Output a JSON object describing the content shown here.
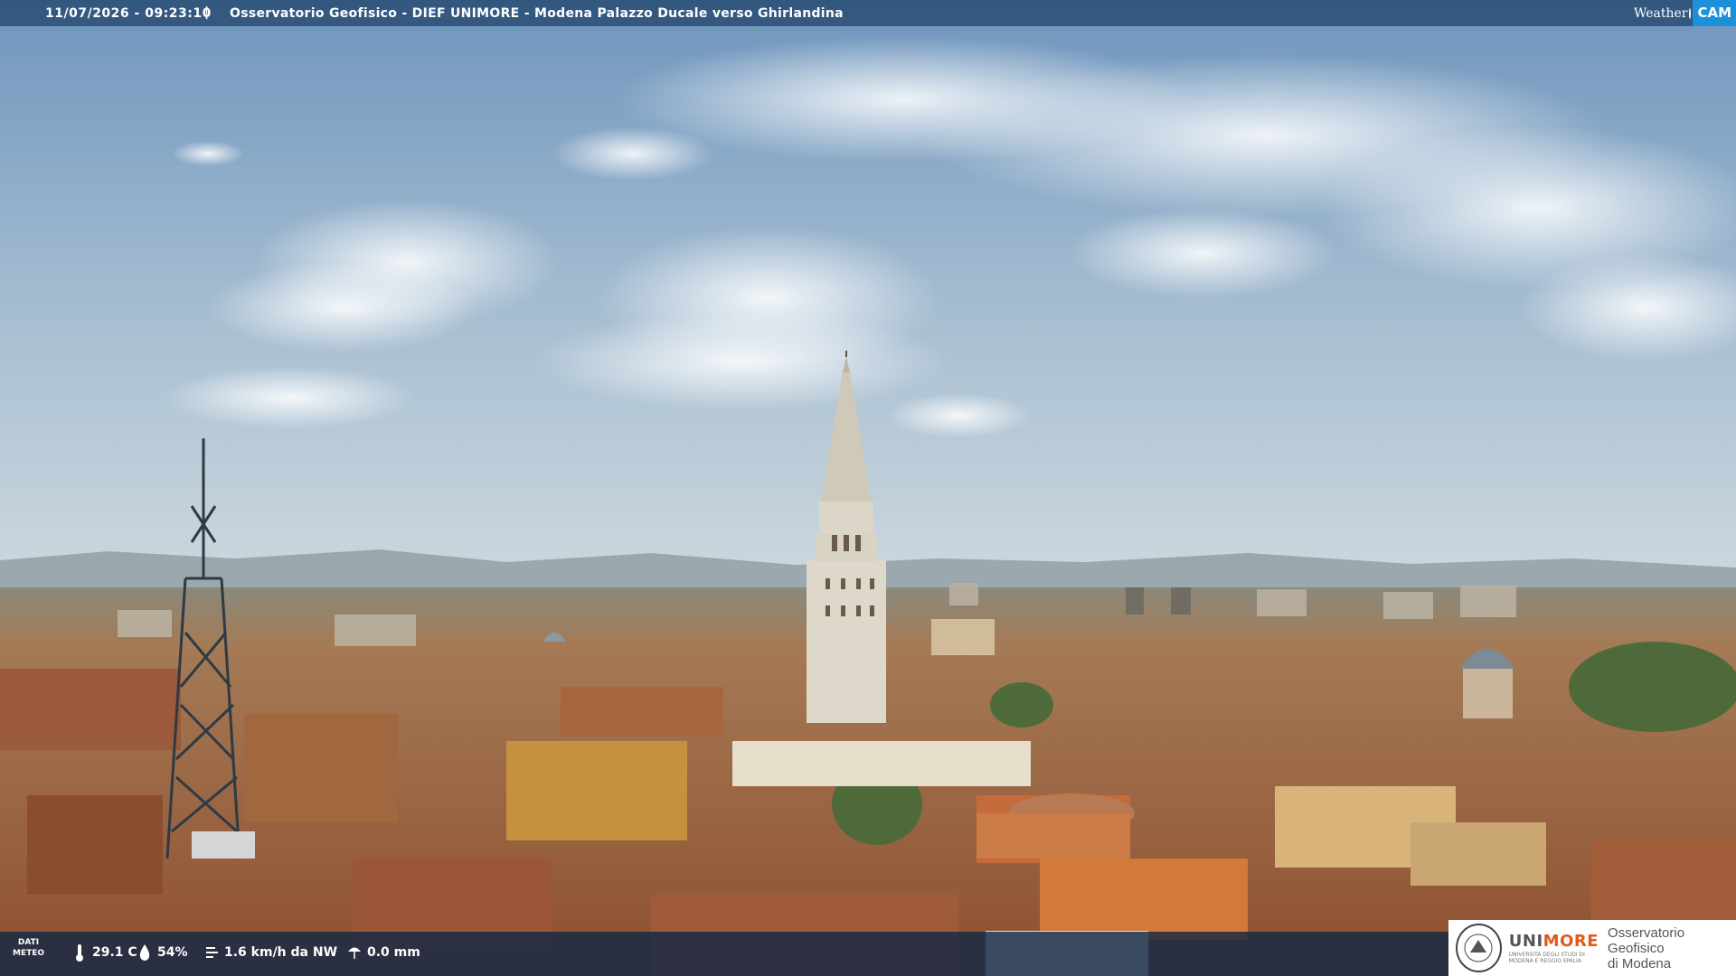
{
  "header": {
    "timestamp": "11/07/2026 - 09:23:10",
    "separator": "|",
    "title": "Osservatorio Geofisico - DIEF UNIMORE - Modena Palazzo Ducale verso Ghirlandina"
  },
  "brand": {
    "weather": "Weather",
    "cam": "CAM"
  },
  "meteo": {
    "label_line1": "DATI",
    "label_line2": "METEO",
    "temperature": "29.1 C",
    "humidity": "54%",
    "wind": "1.6 km/h da NW",
    "rain": "0.0 mm"
  },
  "footer_logo": {
    "uni": "UNI",
    "more": "MORE",
    "subtitle_line1": "UNIVERSITÀ DEGLI STUDI DI",
    "subtitle_line2": "MODENA E REGGIO EMILIA",
    "observatory_line1": "Osservatorio Geofisico",
    "observatory_line2": "di Modena"
  },
  "colors": {
    "sky_top": "#6f95bd",
    "sky_horizon": "#c9d6df",
    "roof": "#a8643f",
    "stone": "#d8d2c4",
    "accent_orange": "#e05a1a",
    "cam_blue": "#1c90d8"
  }
}
